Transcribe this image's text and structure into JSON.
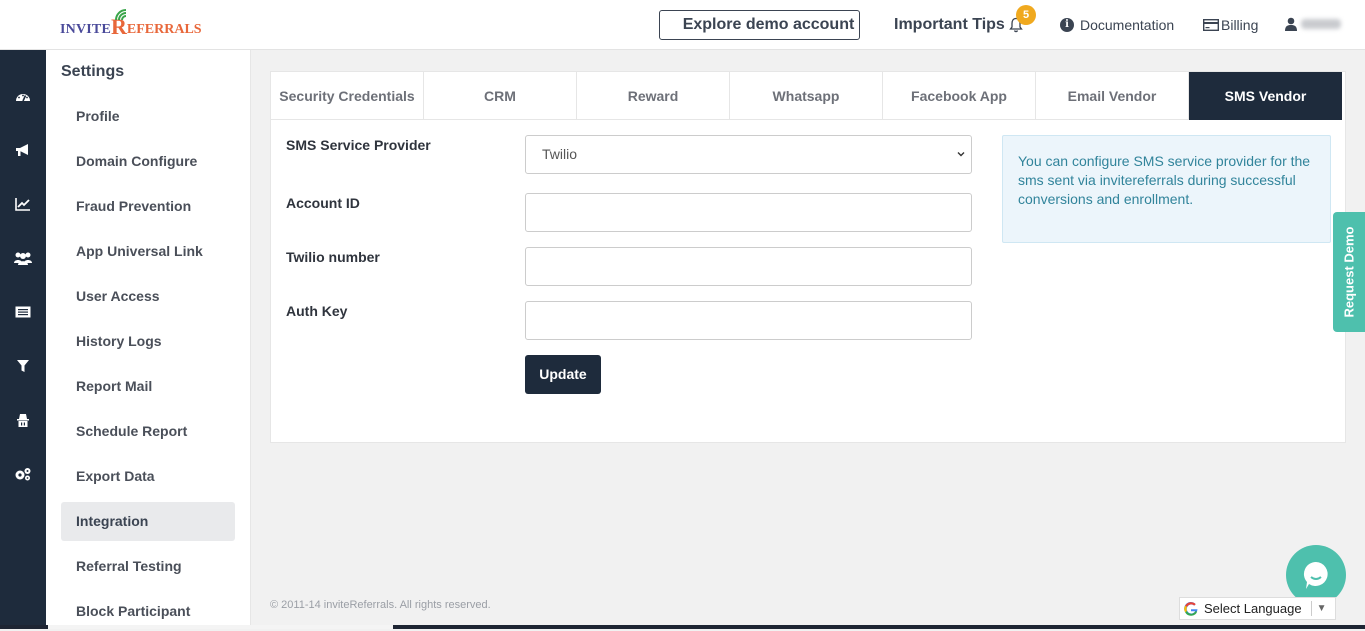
{
  "brand": {
    "logo_prefix": "INVITE",
    "logo_r": "R",
    "logo_suffix": "EFERRALS"
  },
  "header": {
    "explore_label": "Explore demo account",
    "tips_label": "Important Tips",
    "tips_badge": "5",
    "documentation_label": "Documentation",
    "billing_label": "Billing",
    "user_name": "(blurred)"
  },
  "rail": {
    "icons": [
      "dashboard-icon",
      "campaign-megaphone-icon",
      "analytics-chart-icon",
      "users-icon",
      "list-icon",
      "filter-icon",
      "privacy-icon",
      "settings-cogs-icon"
    ]
  },
  "settings": {
    "title": "Settings",
    "items": [
      {
        "label": "Profile"
      },
      {
        "label": "Domain Configure"
      },
      {
        "label": "Fraud Prevention"
      },
      {
        "label": "App Universal Link"
      },
      {
        "label": "User Access"
      },
      {
        "label": "History Logs"
      },
      {
        "label": "Report Mail"
      },
      {
        "label": "Schedule Report"
      },
      {
        "label": "Export Data"
      },
      {
        "label": "Integration",
        "active": true
      },
      {
        "label": "Referral Testing"
      },
      {
        "label": "Block Participant"
      }
    ]
  },
  "tabs": [
    {
      "label": "Security Credentials"
    },
    {
      "label": "CRM"
    },
    {
      "label": "Reward"
    },
    {
      "label": "Whatsapp"
    },
    {
      "label": "Facebook App"
    },
    {
      "label": "Email Vendor"
    },
    {
      "label": "SMS Vendor",
      "active": true
    }
  ],
  "form": {
    "provider_label": "SMS Service Provider",
    "provider_value": "Twilio",
    "account_id_label": "Account ID",
    "account_id_value": "",
    "twilio_number_label": "Twilio number",
    "twilio_number_value": "",
    "auth_key_label": "Auth Key",
    "auth_key_value": "",
    "update_label": "Update"
  },
  "note": "You can configure SMS service provider for the sms sent via invitereferrals during successful conversions and enrollment.",
  "request_demo_label": "Request Demo",
  "footer": "© 2011-14 inviteReferrals. All rights reserved.",
  "language": {
    "label": "Select Language"
  },
  "colors": {
    "navy": "#1e2b3c",
    "teal": "#4ec0ad",
    "badge": "#f0a91f",
    "note_text": "#31849b"
  }
}
